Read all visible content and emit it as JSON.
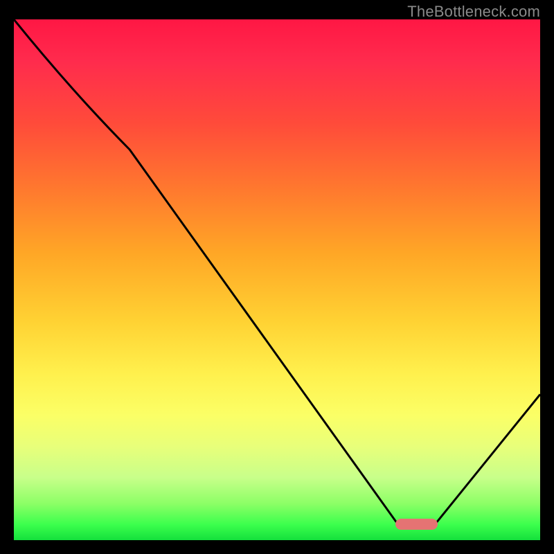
{
  "watermark": "TheBottleneck.com",
  "chart_data": {
    "type": "line",
    "title": "",
    "xlabel": "",
    "ylabel": "",
    "xlim": [
      0,
      100
    ],
    "ylim": [
      0,
      100
    ],
    "grid": false,
    "series": [
      {
        "name": "bottleneck-curve",
        "x": [
          0,
          22,
          73,
          80,
          100
        ],
        "values": [
          100,
          75,
          3,
          3,
          28
        ]
      }
    ],
    "annotations": [
      {
        "name": "optimal-marker",
        "x": 76.5,
        "y": 3,
        "width_pct": 8,
        "color": "#e57373"
      }
    ],
    "background": "rainbow-vertical-red-to-green"
  },
  "colors": {
    "curve": "#000000",
    "marker": "#e57373",
    "frame_bg": "#000000",
    "watermark": "#8a8a8a"
  }
}
